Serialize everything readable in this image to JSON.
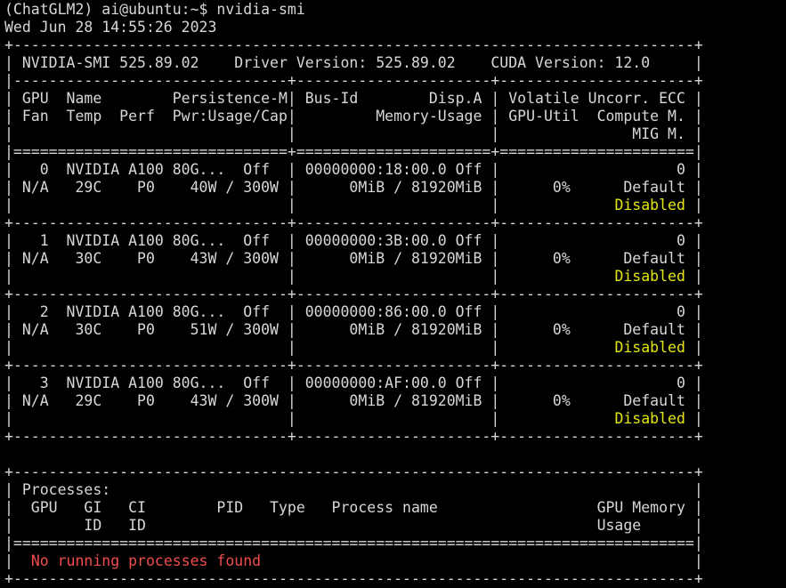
{
  "prompt": {
    "line": "(ChatGLM2) ai@ubuntu:~$ nvidia-smi"
  },
  "datetime": "Wed Jun 28 14:55:26 2023",
  "header": {
    "border_top": "+-----------------------------------------------------------------------------+",
    "versions": "| NVIDIA-SMI 525.89.02    Driver Version: 525.89.02    CUDA Version: 12.0     |",
    "sep1": "|-------------------------------+----------------------+----------------------+",
    "cols1": "| GPU  Name        Persistence-M| Bus-Id        Disp.A | Volatile Uncorr. ECC |",
    "cols2": "| Fan  Temp  Perf  Pwr:Usage/Cap|         Memory-Usage | GPU-Util  Compute M. |",
    "cols3": "|                               |                      |               MIG M. |",
    "sep2": "|===============================+======================+======================|"
  },
  "gpus": [
    {
      "l1": "|   0  NVIDIA A100 80G...  Off  | 00000000:18:00.0 Off |                    0 |",
      "l2": "| N/A   29C    P0    40W / 300W |      0MiB / 81920MiB |      0%      Default |",
      "l3_pre": "|                               |                      |             ",
      "l3_mig": "Disabled",
      "l3_post": " |",
      "sep": "+-------------------------------+----------------------+----------------------+"
    },
    {
      "l1": "|   1  NVIDIA A100 80G...  Off  | 00000000:3B:00.0 Off |                    0 |",
      "l2": "| N/A   30C    P0    43W / 300W |      0MiB / 81920MiB |      0%      Default |",
      "l3_pre": "|                               |                      |             ",
      "l3_mig": "Disabled",
      "l3_post": " |",
      "sep": "+-------------------------------+----------------------+----------------------+"
    },
    {
      "l1": "|   2  NVIDIA A100 80G...  Off  | 00000000:86:00.0 Off |                    0 |",
      "l2": "| N/A   30C    P0    51W / 300W |      0MiB / 81920MiB |      0%      Default |",
      "l3_pre": "|                               |                      |             ",
      "l3_mig": "Disabled",
      "l3_post": " |",
      "sep": "+-------------------------------+----------------------+----------------------+"
    },
    {
      "l1": "|   3  NVIDIA A100 80G...  Off  | 00000000:AF:00.0 Off |                    0 |",
      "l2": "| N/A   29C    P0    43W / 300W |      0MiB / 81920MiB |      0%      Default |",
      "l3_pre": "|                               |                      |             ",
      "l3_mig": "Disabled",
      "l3_post": " |",
      "sep": "+-------------------------------+----------------------+----------------------+"
    }
  ],
  "processes": {
    "border_top": "+-----------------------------------------------------------------------------+",
    "title": "| Processes:                                                                  |",
    "cols1": "|  GPU   GI   CI        PID   Type   Process name                  GPU Memory |",
    "cols2": "|        ID   ID                                                   Usage      |",
    "sep": "|=============================================================================|",
    "none_pre": "|  ",
    "none_text": "No running processes found",
    "none_post": "                                                 |",
    "border_bottom": "+-----------------------------------------------------------------------------+"
  },
  "colors": {
    "background": "#000000",
    "text": "#d7d7d7",
    "mig_disabled": "#e5e510",
    "no_processes": "#f14c4c"
  }
}
